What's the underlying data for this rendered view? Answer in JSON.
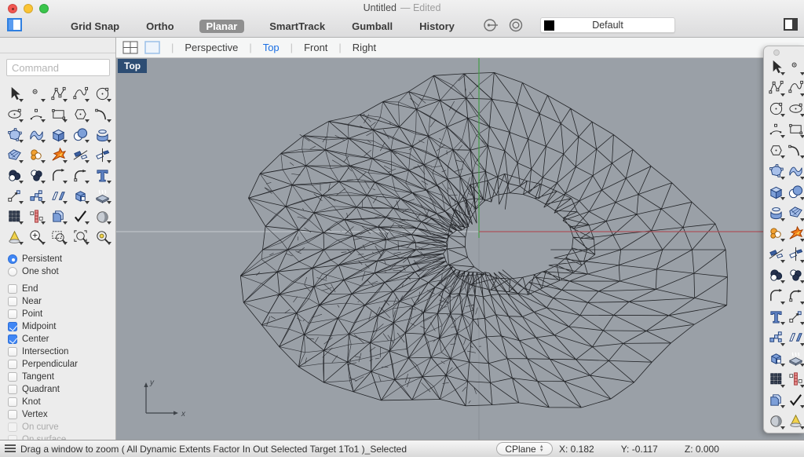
{
  "window": {
    "title": "Untitled",
    "title_suffix": "— Edited"
  },
  "toolbar": {
    "toggles": [
      {
        "label": "Grid Snap",
        "active": false
      },
      {
        "label": "Ortho",
        "active": false
      },
      {
        "label": "Planar",
        "active": true
      },
      {
        "label": "SmartTrack",
        "active": false
      },
      {
        "label": "Gumball",
        "active": false
      },
      {
        "label": "History",
        "active": false
      }
    ],
    "icons": [
      "record-history-icon",
      "target-circles-icon"
    ],
    "layer": {
      "name": "Default",
      "swatch_color": "#000000"
    }
  },
  "command_input": {
    "placeholder": "Command"
  },
  "tool_grid": {
    "icons": [
      "pointer",
      "point",
      "polyline",
      "curve",
      "circle",
      "ellipse",
      "arc",
      "rectangle",
      "polygon",
      "blend",
      "srf-corner",
      "srf-curve",
      "box",
      "sphere",
      "torus",
      "patch",
      "puzzle",
      "explode",
      "trim",
      "split",
      "union",
      "diff",
      "fillet",
      "fillet2",
      "text",
      "move",
      "array",
      "mirror",
      "cube2",
      "heat",
      "gridarray",
      "align",
      "copy2",
      "check",
      "shade",
      "lamp",
      "zoomplus",
      "zoomwin",
      "zoomsel",
      "zoomtarget"
    ]
  },
  "osnap": {
    "modes": [
      {
        "label": "Persistent",
        "selected": true
      },
      {
        "label": "One shot",
        "selected": false
      }
    ],
    "snaps": [
      {
        "label": "End",
        "checked": false,
        "disabled": false
      },
      {
        "label": "Near",
        "checked": false,
        "disabled": false
      },
      {
        "label": "Point",
        "checked": false,
        "disabled": false
      },
      {
        "label": "Midpoint",
        "checked": true,
        "disabled": false
      },
      {
        "label": "Center",
        "checked": true,
        "disabled": false
      },
      {
        "label": "Intersection",
        "checked": false,
        "disabled": false
      },
      {
        "label": "Perpendicular",
        "checked": false,
        "disabled": false
      },
      {
        "label": "Tangent",
        "checked": false,
        "disabled": false
      },
      {
        "label": "Quadrant",
        "checked": false,
        "disabled": false
      },
      {
        "label": "Knot",
        "checked": false,
        "disabled": false
      },
      {
        "label": "Vertex",
        "checked": false,
        "disabled": false
      },
      {
        "label": "On curve",
        "checked": false,
        "disabled": true
      },
      {
        "label": "On surface",
        "checked": false,
        "disabled": true
      }
    ]
  },
  "viewport": {
    "tabs": [
      "Perspective",
      "Top",
      "Front",
      "Right"
    ],
    "active_tab": "Top",
    "badge": "Top",
    "axis_labels": {
      "x": "x",
      "y": "y"
    }
  },
  "right_palette": {
    "icons": [
      "pointer",
      "point",
      "polyline",
      "curve",
      "circle",
      "ellipse",
      "arc",
      "rectangle",
      "polygon",
      "blend",
      "srf-corner",
      "srf-curve",
      "box",
      "sphere",
      "torus",
      "patch",
      "puzzle",
      "explode",
      "trim",
      "split",
      "union",
      "diff",
      "fillet",
      "fillet2",
      "text",
      "move",
      "array",
      "mirror",
      "cube2",
      "heat",
      "gridarray",
      "align",
      "copy2",
      "check",
      "shade",
      "lamp"
    ]
  },
  "status_bar": {
    "message": "Drag a window to zoom ( All Dynamic Extents Factor In Out Selected Target 1To1 )_Selected",
    "cplane": "CPlane",
    "coord_x": "X: 0.182",
    "coord_y": "Y: -0.117",
    "coord_z": "Z: 0.000"
  },
  "colors": {
    "accent_blue": "#1b6fe3",
    "viewport_bg": "#9aa0a7",
    "axis_x_positive": "#ad4f58",
    "axis_y_positive": "#3f9e42",
    "badge_bg": "#2d4d73",
    "layer_swatch": "#000000"
  }
}
